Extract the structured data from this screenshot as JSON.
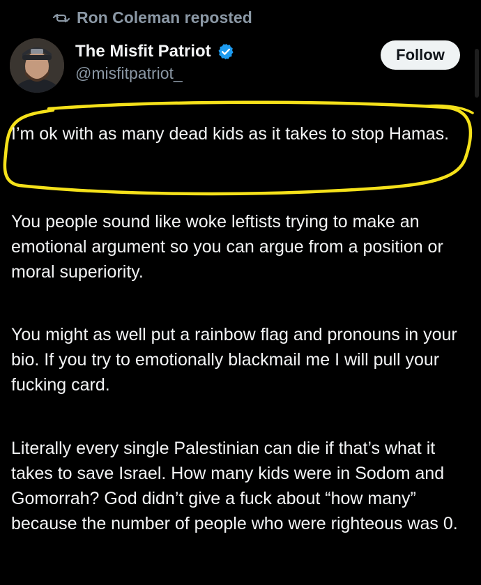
{
  "repost": {
    "label": "Ron Coleman reposted",
    "icon": "repost-icon"
  },
  "author": {
    "display_name": "The Misfit Patriot",
    "handle": "@misfitpatriot_",
    "verified": true,
    "verified_icon": "verified-badge-icon"
  },
  "follow_button": {
    "label": "Follow"
  },
  "post": {
    "paragraphs": [
      "I’m ok with as many dead kids as it takes to stop Hamas.",
      "You people sound like woke leftists trying to make an emotional argument so you can argue from a position or moral superiority.",
      "You might as well put a rainbow flag and pronouns in your bio. If you try to emotionally blackmail me I will pull your fucking card.",
      "Literally every single Palestinian can die if that’s what it takes to save Israel. How many kids were in Sodom and Gomorrah? God didn’t give a fuck about “how many” because the number of people who were righteous was 0."
    ]
  },
  "colors": {
    "background": "#000000",
    "text_primary": "#e7e9ea",
    "text_secondary": "#8b98a5",
    "verified_blue": "#1d9bf0",
    "follow_bg": "#eff3f4",
    "highlight_marker": "#f5e11a"
  }
}
